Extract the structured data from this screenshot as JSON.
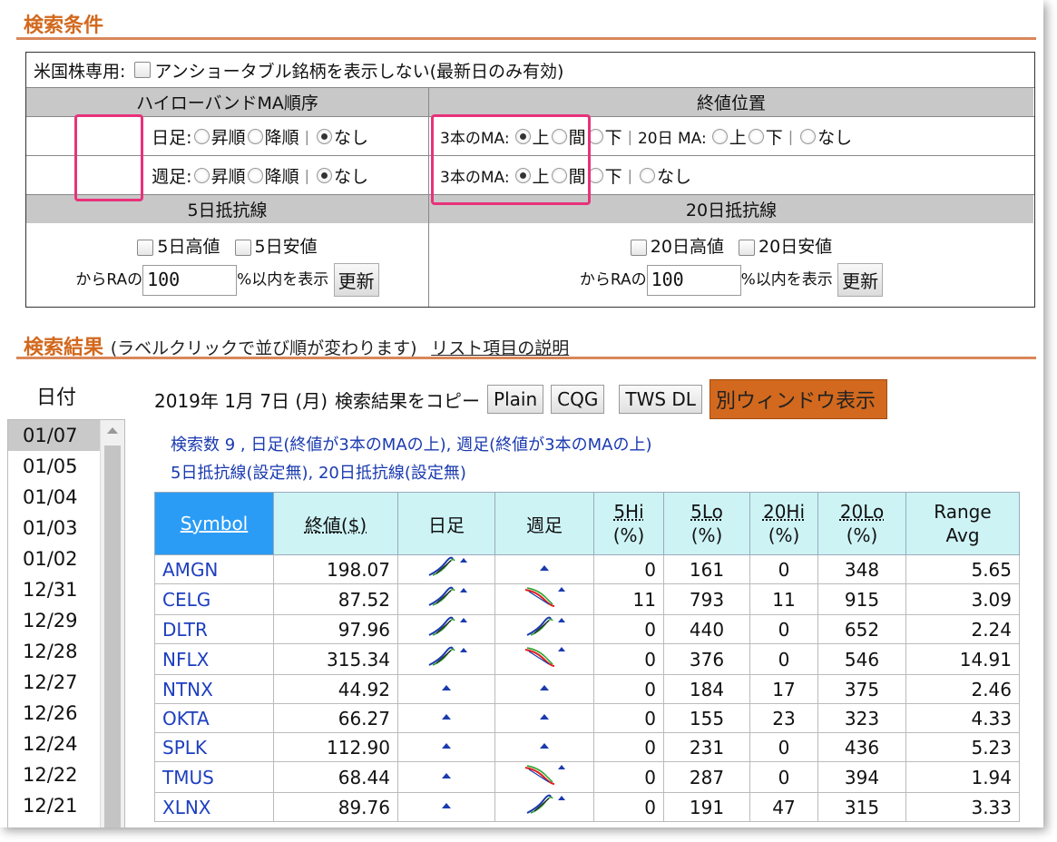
{
  "search_conditions": {
    "title": "検索条件",
    "us_only_label": "米国株専用:",
    "unshortable_label": "アンショータブル銘柄を表示しない(最新日のみ有効)",
    "highlow_head": "ハイローバンドMA順序",
    "close_head": "終値位置",
    "daily_label": "日足:",
    "weekly_label": "週足:",
    "asc": "昇順",
    "desc": "降順",
    "none": "なし",
    "ma3_label": "3本のMA:",
    "ma20_label": "20日 MA:",
    "above": "上",
    "between": "間",
    "below": "下",
    "res5_head": "5日抵抗線",
    "res20_head": "20日抵抗線",
    "hi5": "5日高値",
    "lo5": "5日安値",
    "hi20": "20日高値",
    "lo20": "20日安値",
    "ra_prefix": "からRAの",
    "ra_suffix": "%以内を表示",
    "ra_value_5": "100",
    "ra_value_20": "100",
    "update": "更新"
  },
  "results": {
    "title": "検索結果",
    "subtitle": "(ラベルクリックで並び順が変わります)",
    "help_link": "リスト項目の説明",
    "date_header": "日付",
    "dates": [
      "01/07",
      "01/05",
      "01/04",
      "01/03",
      "01/02",
      "12/31",
      "12/29",
      "12/28",
      "12/27",
      "12/26",
      "12/24",
      "12/22",
      "12/21"
    ],
    "selected_date": "01/07",
    "date_line": "2019年 1月 7日 (月)",
    "copy_label": "検索結果をコピー",
    "plain": "Plain",
    "cqg": "CQG",
    "tws": "TWS DL",
    "new_window": "別ウィンドウ表示",
    "summary1": "検索数 9 , 日足(終値が3本のMAの上), 週足(終値が3本のMAの上)",
    "summary2": "5日抵抗線(設定無), 20日抵抗線(設定無)",
    "columns": {
      "symbol": "Symbol",
      "close": "終値($)",
      "daily": "日足",
      "weekly": "週足",
      "hi5": "5Hi",
      "lo5": "5Lo",
      "hi20": "20Hi",
      "lo20": "20Lo",
      "pct": "(%)",
      "range": "Range",
      "avg": "Avg"
    },
    "rows": [
      {
        "symbol": "AMGN",
        "close": "198.07",
        "daily": "up",
        "weekly": "dot",
        "hi5": "0",
        "lo5": "161",
        "hi20": "0",
        "lo20": "348",
        "range": "5.65"
      },
      {
        "symbol": "CELG",
        "close": "87.52",
        "daily": "up",
        "weekly": "down",
        "hi5": "11",
        "lo5": "793",
        "hi20": "11",
        "lo20": "915",
        "range": "3.09"
      },
      {
        "symbol": "DLTR",
        "close": "97.96",
        "daily": "up",
        "weekly": "up",
        "hi5": "0",
        "lo5": "440",
        "hi20": "0",
        "lo20": "652",
        "range": "2.24"
      },
      {
        "symbol": "NFLX",
        "close": "315.34",
        "daily": "up",
        "weekly": "down",
        "hi5": "0",
        "lo5": "376",
        "hi20": "0",
        "lo20": "546",
        "range": "14.91"
      },
      {
        "symbol": "NTNX",
        "close": "44.92",
        "daily": "dot",
        "weekly": "dot",
        "hi5": "0",
        "lo5": "184",
        "hi20": "17",
        "lo20": "375",
        "range": "2.46"
      },
      {
        "symbol": "OKTA",
        "close": "66.27",
        "daily": "dot",
        "weekly": "dot",
        "hi5": "0",
        "lo5": "155",
        "hi20": "23",
        "lo20": "323",
        "range": "4.33"
      },
      {
        "symbol": "SPLK",
        "close": "112.90",
        "daily": "dot",
        "weekly": "dot",
        "hi5": "0",
        "lo5": "231",
        "hi20": "0",
        "lo20": "436",
        "range": "5.23"
      },
      {
        "symbol": "TMUS",
        "close": "68.44",
        "daily": "dot",
        "weekly": "down",
        "hi5": "0",
        "lo5": "287",
        "hi20": "0",
        "lo20": "394",
        "range": "1.94"
      },
      {
        "symbol": "XLNX",
        "close": "89.76",
        "daily": "dot",
        "weekly": "up",
        "hi5": "0",
        "lo5": "191",
        "hi20": "47",
        "lo20": "315",
        "range": "3.33"
      }
    ]
  },
  "colors": {
    "accent": "#d2691e",
    "symbol_header": "#2a9cf5",
    "link": "#1d3fbf",
    "highlight": "#e8327a"
  }
}
